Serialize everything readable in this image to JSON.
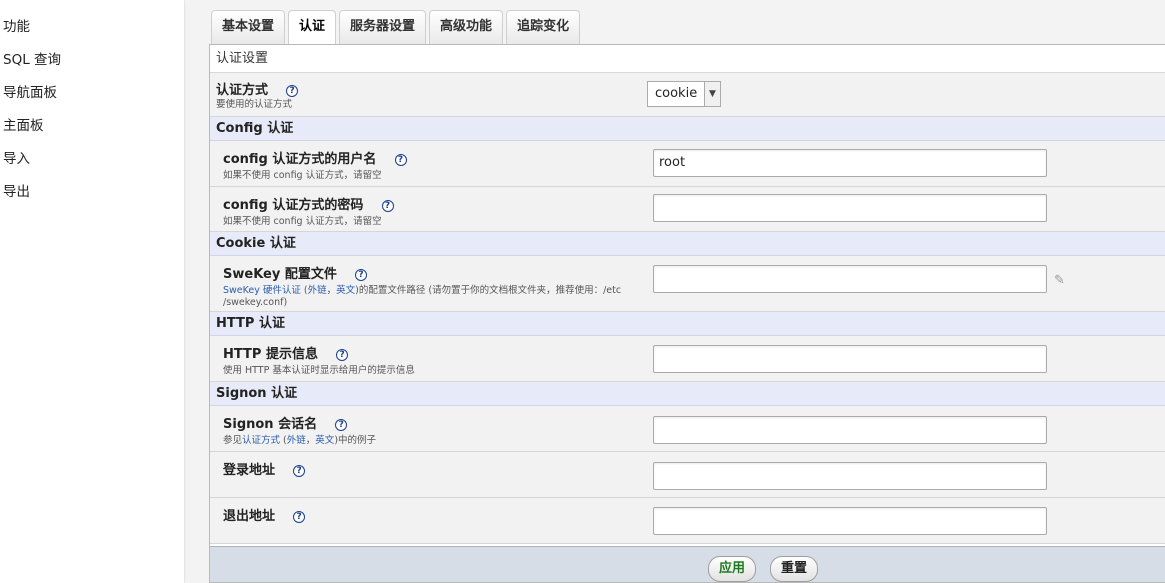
{
  "sidebar": {
    "items": [
      {
        "label": "功能"
      },
      {
        "label": "SQL 查询"
      },
      {
        "label": "导航面板"
      },
      {
        "label": "主面板"
      },
      {
        "label": "导入"
      },
      {
        "label": "导出"
      }
    ]
  },
  "tabs": [
    {
      "label": "基本设置",
      "active": false
    },
    {
      "label": "认证",
      "active": true
    },
    {
      "label": "服务器设置",
      "active": false
    },
    {
      "label": "高级功能",
      "active": false
    },
    {
      "label": "追踪变化",
      "active": false
    }
  ],
  "panel": {
    "legend": "认证设置",
    "auth_type": {
      "label": "认证方式",
      "desc": "要使用的认证方式",
      "value": "cookie"
    },
    "sections": {
      "config": "Config 认证",
      "cookie": "Cookie 认证",
      "http": "HTTP 认证",
      "signon": "Signon 认证"
    },
    "config_user": {
      "label": "config 认证方式的用户名",
      "desc": "如果不使用 config 认证方式，请留空",
      "value": "root"
    },
    "config_password": {
      "label": "config 认证方式的密码",
      "desc": "如果不使用 config 认证方式，请留空",
      "value": ""
    },
    "swekey": {
      "label": "SweKey 配置文件",
      "desc_link1": "SweKey 硬件认证",
      "desc_open": " (",
      "desc_link2": "外链",
      "desc_comma": "，",
      "desc_link3": "英文",
      "desc_rest": ")的配置文件路径 (请勿置于你的文档根文件夹，推荐使用：/etc /swekey.conf)",
      "value": ""
    },
    "http_realm": {
      "label": "HTTP 提示信息",
      "desc": "使用 HTTP 基本认证时显示给用户的提示信息",
      "value": ""
    },
    "signon_session": {
      "label": "Signon 会话名",
      "desc_pre": "参见",
      "desc_link1": "认证方式",
      "desc_open": " (",
      "desc_link2": "外链",
      "desc_comma": "，",
      "desc_link3": "英文",
      "desc_rest": ")中的例子",
      "value": ""
    },
    "signon_url": {
      "label": "登录地址",
      "value": ""
    },
    "logout_url": {
      "label": "退出地址",
      "value": ""
    },
    "help_glyph": "?",
    "apply_label": "应用",
    "reset_label": "重置"
  },
  "colors": {
    "section_bg": "#e7eaf8",
    "row_bg": "#f2f2f2",
    "footer_bg": "#d6dde6",
    "apply_text": "#1f7a1f",
    "link": "#2a5db0"
  },
  "icons": {
    "help": "question-circle-icon",
    "select_arrow": "chevron-down-icon",
    "edit": "pencil-icon"
  }
}
